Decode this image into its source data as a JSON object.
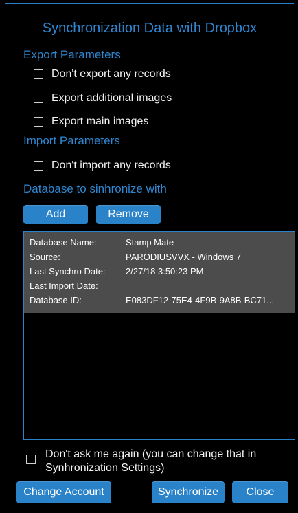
{
  "dialog": {
    "title": "Synchronization Data with Dropbox"
  },
  "export_params": {
    "heading": "Export Parameters",
    "options": [
      {
        "label": "Don't export any records",
        "checked": false
      },
      {
        "label": "Export additional images",
        "checked": false
      },
      {
        "label": "Export main images",
        "checked": false
      }
    ]
  },
  "import_params": {
    "heading": "Import Parameters",
    "options": [
      {
        "label": "Don't import any records",
        "checked": false
      }
    ]
  },
  "database": {
    "heading": "Database to sinhronize with",
    "add_label": "Add",
    "remove_label": "Remove",
    "records": [
      {
        "name_label": "Database Name:",
        "name_value": "Stamp Mate",
        "source_label": "Source:",
        "source_value": "PARODIUSVVX - Windows 7",
        "last_sync_label": "Last Synchro Date:",
        "last_sync_value": "2/27/18 3:50:23 PM",
        "last_import_label": "Last Import Date:",
        "last_import_value": "",
        "id_label": "Database ID:",
        "id_value": "E083DF12-75E4-4F9B-9A8B-BC71..."
      }
    ]
  },
  "dont_ask": {
    "label": "Don't ask me again (you can change that in Synhronization Settings)",
    "checked": false
  },
  "footer": {
    "change_account_label": "Change Account",
    "synchronize_label": "Synchronize",
    "close_label": "Close"
  },
  "colors": {
    "accent": "#2a82c9",
    "heading": "#2f86cf",
    "record_bg": "#4c4c4c",
    "background": "#000000"
  }
}
